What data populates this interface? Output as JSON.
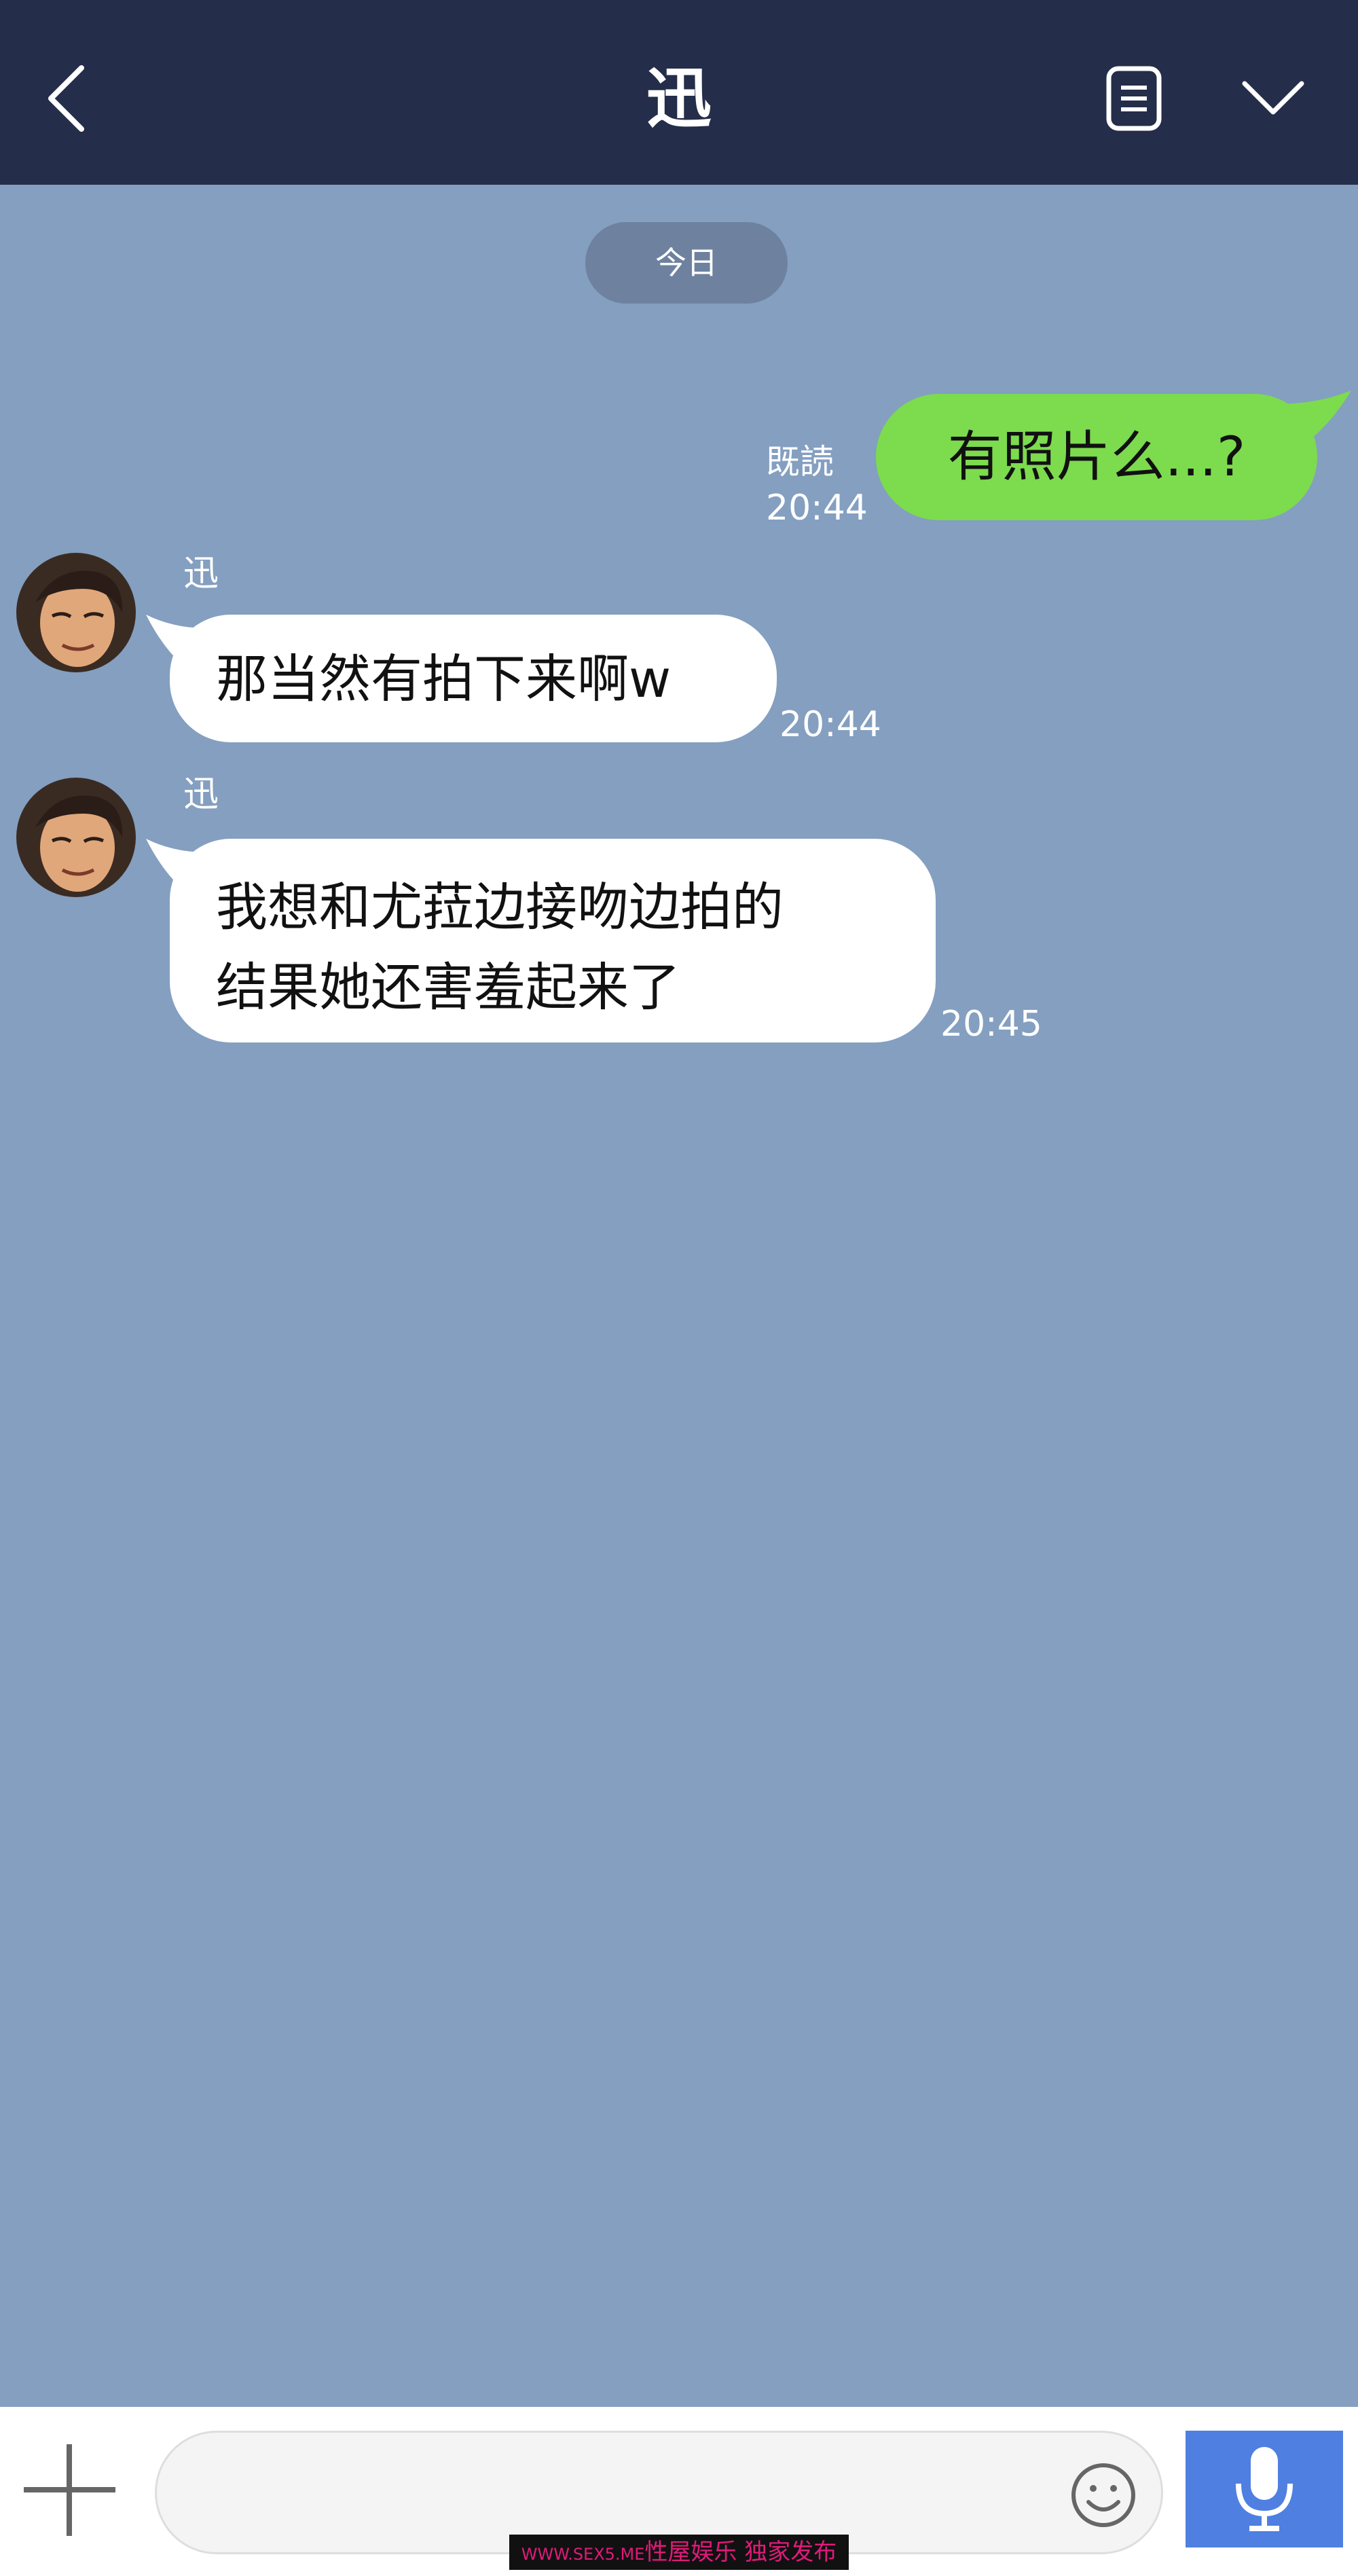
{
  "header": {
    "title": "迅",
    "back_icon": "chevron-left-icon",
    "memo_icon": "note-icon",
    "menu_icon": "chevron-down-icon"
  },
  "date_divider": "今日",
  "messages": [
    {
      "direction": "out",
      "text": "有照片么...?",
      "read_label": "既読",
      "time": "20:44"
    },
    {
      "direction": "in",
      "sender": "迅",
      "lines": [
        "那当然有拍下来啊w"
      ],
      "time": "20:44"
    },
    {
      "direction": "in",
      "sender": "迅",
      "lines": [
        "我想和尤菈边接吻边拍的",
        "结果她还害羞起来了"
      ],
      "time": "20:45"
    }
  ],
  "composer": {
    "value": "",
    "placeholder": "",
    "plus_icon": "plus-icon",
    "emoji_icon": "smiley-icon",
    "mic_icon": "microphone-icon"
  },
  "watermark": {
    "site": "WWW.SEX5.ME",
    "text": "性屋娱乐 独家发布"
  },
  "colors": {
    "header_bg": "#242d4a",
    "chat_bg": "#849fc0",
    "outgoing_bubble": "#7ddb4e",
    "incoming_bubble": "#ffffff",
    "mic_button": "#4f7fe0"
  }
}
